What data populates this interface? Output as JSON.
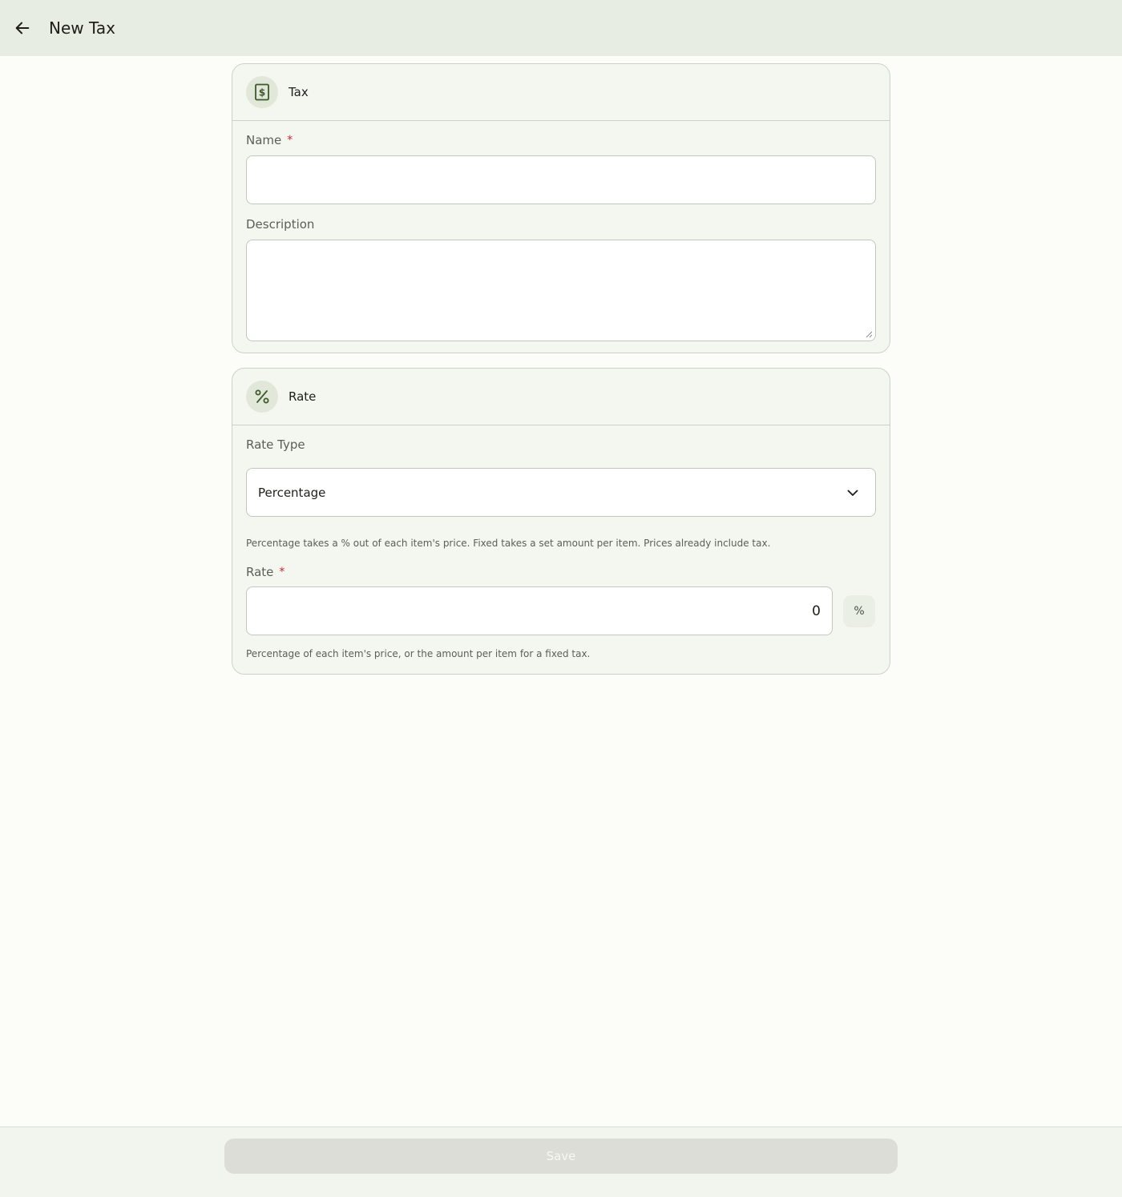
{
  "header": {
    "title": "New Tax",
    "back_icon": "arrow-left-icon"
  },
  "tax_card": {
    "title": "Tax",
    "icon": "receipt-dollar-icon",
    "name": {
      "label": "Name",
      "required_mark": "*",
      "value": "",
      "placeholder": ""
    },
    "description": {
      "label": "Description",
      "value": "",
      "placeholder": ""
    }
  },
  "rate_card": {
    "title": "Rate",
    "icon": "percent-icon",
    "rate_type": {
      "label": "Rate Type",
      "selected": "Percentage",
      "helper": "Percentage takes a % out of each item's price. Fixed takes a set amount per item. Prices already include tax."
    },
    "rate": {
      "label": "Rate",
      "required_mark": "*",
      "value": "0",
      "unit": "%",
      "helper": "Percentage of each item's price, or the amount per item for a fixed tax."
    }
  },
  "footer": {
    "save_label": "Save",
    "save_disabled": true
  },
  "colors": {
    "topbar_bg": "#e7ede2",
    "card_bg": "#f4f7f0",
    "accent": "#3d5a2a",
    "required": "#c62828",
    "save_disabled_bg": "#dcddd6"
  }
}
